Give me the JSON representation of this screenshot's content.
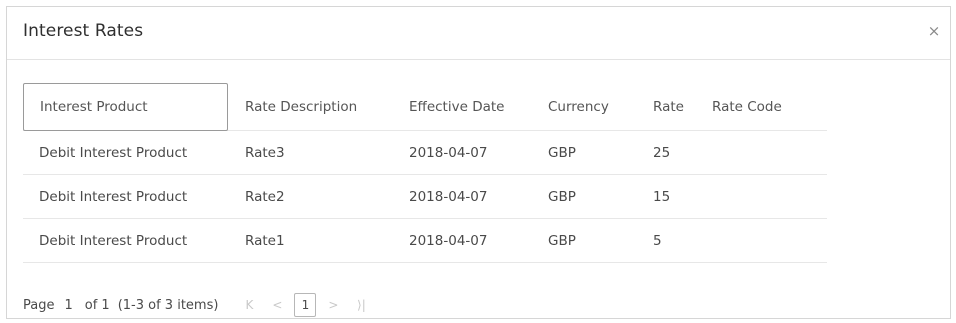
{
  "dialog": {
    "title": "Interest Rates",
    "close_glyph": "×"
  },
  "table": {
    "columns": [
      "Interest Product",
      "Rate Description",
      "Effective Date",
      "Currency",
      "Rate",
      "Rate Code"
    ],
    "rows": [
      [
        "Debit Interest Product",
        "Rate3",
        "2018-04-07",
        "GBP",
        "25",
        ""
      ],
      [
        "Debit Interest Product",
        "Rate2",
        "2018-04-07",
        "GBP",
        "15",
        ""
      ],
      [
        "Debit Interest Product",
        "Rate1",
        "2018-04-07",
        "GBP",
        "5",
        ""
      ]
    ]
  },
  "pagination": {
    "page_label": "Page",
    "page_number": "1",
    "of_total": "of 1",
    "items_summary": "(1-3 of 3 items)",
    "first_glyph": "K",
    "prev_glyph": "<",
    "current_page": "1",
    "next_glyph": ">",
    "last_glyph": "⟩|"
  }
}
